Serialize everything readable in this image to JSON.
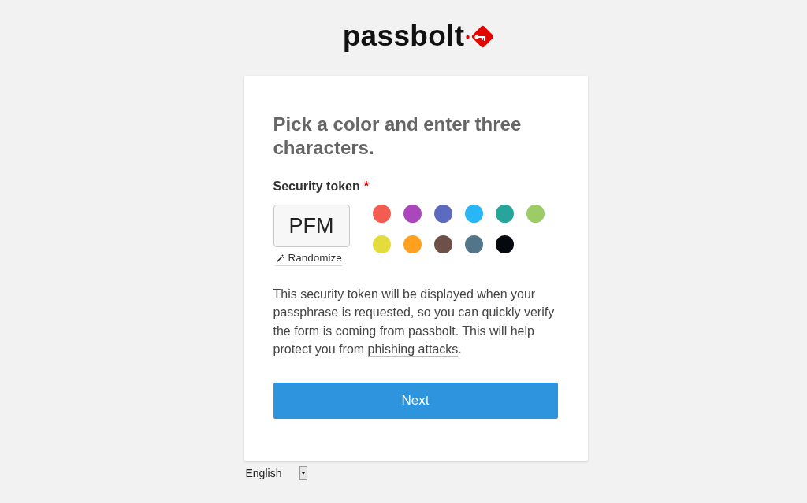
{
  "logo": {
    "text": "passbolt"
  },
  "card": {
    "title": "Pick a color and enter three characters.",
    "field_label": "Security token",
    "required_mark": "*",
    "token": {
      "value": "PFM"
    },
    "randomize": "Randomize",
    "colors": [
      {
        "color": "#f25c51",
        "selected": false
      },
      {
        "color": "#ab47bc",
        "selected": false
      },
      {
        "color": "#5c6bc0",
        "selected": false
      },
      {
        "color": "#29b6f6",
        "selected": false
      },
      {
        "color": "#26a69a",
        "selected": false
      },
      {
        "color": "#9ccc65",
        "selected": false
      },
      {
        "color": "#e4dc3c",
        "selected": false
      },
      {
        "color": "#ffa01e",
        "selected": false
      },
      {
        "color": "#6d5048",
        "selected": false
      },
      {
        "color": "#52758a",
        "selected": false
      },
      {
        "color": "#05090d",
        "selected": false
      }
    ],
    "help_text": "This security token will be displayed when your passphrase is requested, so you can quickly verify the form is coming from passbolt. This will help protect you from",
    "help_link": "phishing attacks",
    "help_end": ".",
    "next_button": "Next"
  },
  "language_select": {
    "value": "English"
  }
}
